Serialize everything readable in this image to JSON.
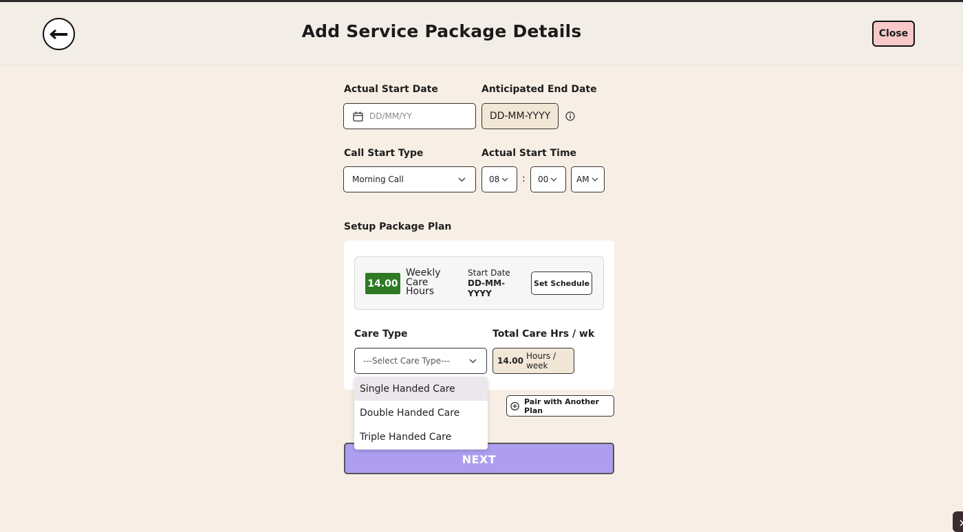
{
  "header": {
    "title": "Add Service Package Details",
    "close_label": "Close"
  },
  "dates": {
    "actual_start_label": "Actual Start Date",
    "actual_start_placeholder": "DD/MM/YY",
    "anticipated_end_label": "Anticipated End Date",
    "anticipated_end_value": "DD-MM-YYYY"
  },
  "call": {
    "start_type_label": "Call Start Type",
    "start_type_value": "Morning Call",
    "start_time_label": "Actual Start Time",
    "hour": "08",
    "separator": ":",
    "minute": "00",
    "meridiem": "AM"
  },
  "plan": {
    "section_label": "Setup Package Plan",
    "hours_badge": "14.00",
    "weekly_label": "Weekly Care Hours",
    "start_date_label": "Start Date",
    "start_date_value": "DD-MM-YYYY",
    "set_schedule_label": "Set Schedule",
    "care_type_label": "Care Type",
    "care_type_placeholder": "---Select Care Type---",
    "total_hours_label": "Total Care Hrs / wk",
    "total_hours_value": "14.00",
    "total_hours_unit": "Hours / week",
    "care_type_options": [
      "Single Handed Care",
      "Double Handed Care",
      "Triple Handed Care"
    ],
    "pair_label": "Pair with Another Plan"
  },
  "footer": {
    "next_label": "NEXT"
  },
  "colors": {
    "page_bg": "#f7efe5",
    "header_bg": "#f2ede6",
    "close_bg": "#f7c9c9",
    "badge_green": "#2e7a24",
    "next_bg": "#ad9ef0",
    "beige_field": "#f2e6d6"
  },
  "icons": [
    "back-arrow-icon",
    "calendar-icon",
    "info-icon",
    "chevron-down-icon",
    "plus-circle-icon",
    "close-icon"
  ]
}
